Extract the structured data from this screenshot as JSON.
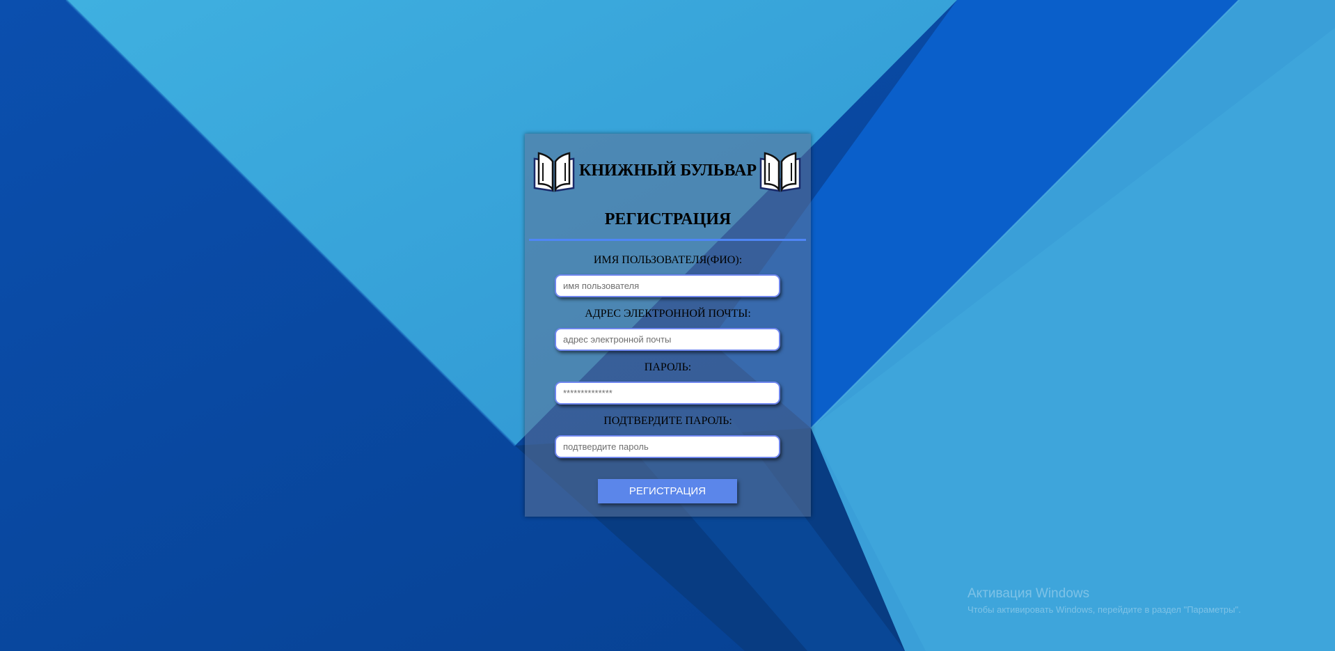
{
  "brand": {
    "title": "КНИЖНЫЙ БУЛЬВАР",
    "logo_icon": "open-book-icon"
  },
  "form": {
    "title": "РЕГИСТРАЦИЯ",
    "fields": [
      {
        "label": "ИМЯ ПОЛЬЗОВАТЕЛЯ(ФИО):",
        "placeholder": "имя пользователя",
        "value": ""
      },
      {
        "label": "АДРЕС ЭЛЕКТРОННОЙ ПОЧТЫ:",
        "placeholder": "адрес электронной почты",
        "value": ""
      },
      {
        "label": "ПАРОЛЬ:",
        "placeholder": "**************",
        "value": ""
      },
      {
        "label": "ПОДТВЕРДИТЕ ПАРОЛЬ:",
        "placeholder": "подтвердите пароль",
        "value": ""
      }
    ],
    "submit_label": "РЕГИСТРАЦИЯ"
  },
  "watermark": {
    "title": "Активация Windows",
    "subtitle": "Чтобы активировать Windows, перейдите в раздел \"Параметры\"."
  },
  "colors": {
    "accent": "#5b86ea",
    "divider": "#4f86f7",
    "background_dark": "#0a4fb0",
    "background_light": "#3aa6dc"
  }
}
